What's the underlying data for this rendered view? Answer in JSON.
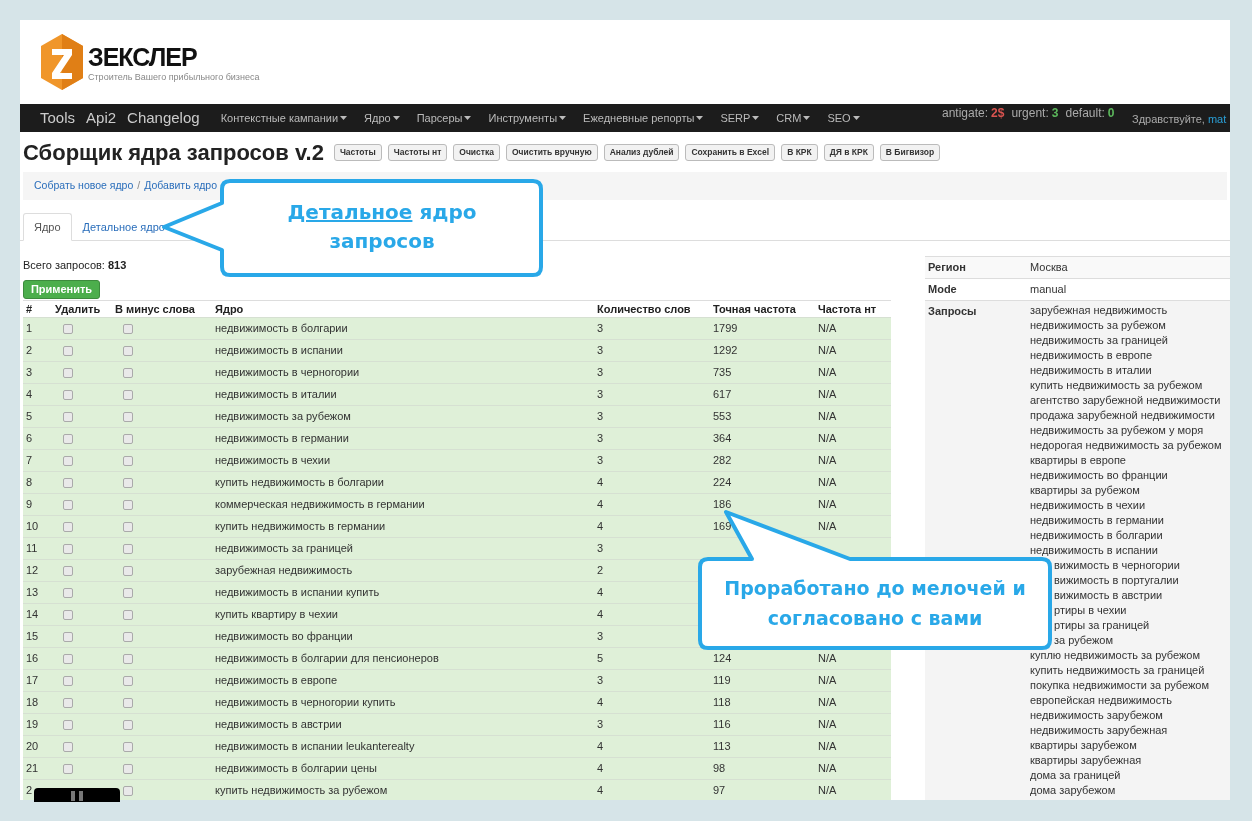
{
  "logo": {
    "name": "ЗЕКСЛЕР",
    "tagline": "Строитель Вашего прибыльного бизнеса"
  },
  "nav": {
    "main": [
      "Tools",
      "Api2",
      "Changelog"
    ],
    "menus": [
      "Контекстные кампании",
      "Ядро",
      "Парсеры",
      "Инструменты",
      "Ежедневные репорты",
      "SERP",
      "CRM",
      "SEO"
    ],
    "status": [
      {
        "label": "antigate:",
        "value": "2$",
        "color": "#d9534f"
      },
      {
        "label": "urgent:",
        "value": "3",
        "color": "#5cb85c"
      },
      {
        "label": "default:",
        "value": "0",
        "color": "#5cb85c"
      }
    ],
    "greeting": "Здравствуйте,",
    "user": "mat"
  },
  "title": "Сборщик ядра запросов v.2",
  "actions": [
    "Частоты",
    "Частоты нт",
    "Очистка",
    "Очистить вручную",
    "Анализ дублей",
    "Сохранить в Excel",
    "В КРК",
    "ДЯ в КРК",
    "В Бигвизор"
  ],
  "breadcrumb": {
    "items": [
      "Собрать новое ядро",
      "Добавить ядро"
    ],
    "separator": "/"
  },
  "tabs": [
    {
      "label": "Ядро",
      "selected": true
    },
    {
      "label": "Детальное ядро",
      "selected": false
    }
  ],
  "total": "Всего запросов: **813**",
  "apply_button": "Применить",
  "table": {
    "columns": [
      "#",
      "Удалить",
      "В минус слова",
      "Ядро",
      "Количество слов",
      "Точная частота",
      "Частота нт"
    ],
    "rows": [
      {
        "n": "1",
        "delete": false,
        "minus": false,
        "phrase": "недвижимость в болгарии",
        "words": "3",
        "freq": "1799",
        "nt": "N/A"
      },
      {
        "n": "2",
        "delete": false,
        "minus": false,
        "phrase": "недвижимость в испании",
        "words": "3",
        "freq": "1292",
        "nt": "N/A"
      },
      {
        "n": "3",
        "delete": false,
        "minus": false,
        "phrase": "недвижимость в черногории",
        "words": "3",
        "freq": "735",
        "nt": "N/A"
      },
      {
        "n": "4",
        "delete": false,
        "minus": false,
        "phrase": "недвижимость в италии",
        "words": "3",
        "freq": "617",
        "nt": "N/A"
      },
      {
        "n": "5",
        "delete": false,
        "minus": false,
        "phrase": "недвижимость за рубежом",
        "words": "3",
        "freq": "553",
        "nt": "N/A"
      },
      {
        "n": "6",
        "delete": false,
        "minus": false,
        "phrase": "недвижимость в германии",
        "words": "3",
        "freq": "364",
        "nt": "N/A"
      },
      {
        "n": "7",
        "delete": false,
        "minus": false,
        "phrase": "недвижимость в чехии",
        "words": "3",
        "freq": "282",
        "nt": "N/A"
      },
      {
        "n": "8",
        "delete": false,
        "minus": false,
        "phrase": "купить недвижимость в болгарии",
        "words": "4",
        "freq": "224",
        "nt": "N/A"
      },
      {
        "n": "9",
        "delete": false,
        "minus": false,
        "phrase": "коммерческая недвижимость в германии",
        "words": "4",
        "freq": "186",
        "nt": "N/A"
      },
      {
        "n": "10",
        "delete": false,
        "minus": false,
        "phrase": "купить недвижимость в германии",
        "words": "4",
        "freq": "169",
        "nt": "N/A"
      },
      {
        "n": "11",
        "delete": false,
        "minus": false,
        "phrase": "недвижимость за границей",
        "words": "3"
      },
      {
        "n": "12",
        "delete": false,
        "minus": false,
        "phrase": "зарубежная недвижимость",
        "words": "2"
      },
      {
        "n": "13",
        "delete": false,
        "minus": false,
        "phrase": "недвижимость в испании купить",
        "words": "4"
      },
      {
        "n": "14",
        "delete": false,
        "minus": false,
        "phrase": "купить квартиру в чехии",
        "words": "4"
      },
      {
        "n": "15",
        "delete": false,
        "minus": false,
        "phrase": "недвижимость во франции",
        "words": "3"
      },
      {
        "n": "16",
        "delete": false,
        "minus": false,
        "phrase": "недвижимость в болгарии для пенсионеров",
        "words": "5",
        "freq": "124",
        "nt": "N/A"
      },
      {
        "n": "17",
        "delete": false,
        "minus": false,
        "phrase": "недвижимость в европе",
        "words": "3",
        "freq": "119",
        "nt": "N/A"
      },
      {
        "n": "18",
        "delete": false,
        "minus": false,
        "phrase": "недвижимость в черногории купить",
        "words": "4",
        "freq": "118",
        "nt": "N/A"
      },
      {
        "n": "19",
        "delete": false,
        "minus": false,
        "phrase": "недвижимость в австрии",
        "words": "3",
        "freq": "116",
        "nt": "N/A"
      },
      {
        "n": "20",
        "delete": false,
        "minus": false,
        "phrase": "недвижимость в испании leukanterealty",
        "words": "4",
        "freq": "113",
        "nt": "N/A"
      },
      {
        "n": "21",
        "delete": false,
        "minus": false,
        "phrase": "недвижимость в болгарии цены",
        "words": "4",
        "freq": "98",
        "nt": "N/A"
      },
      {
        "n": "2",
        "minus": false,
        "phrase": "купить недвижимость за рубежом",
        "words": "4",
        "freq": "97",
        "nt": "N/A"
      }
    ]
  },
  "info": {
    "rows": [
      {
        "label": "Регион",
        "value": "Москва"
      },
      {
        "label": "Mode",
        "value": "manual"
      }
    ],
    "queries_label": "Запросы",
    "queries": [
      {
        "text": "зарубежная недвижимость",
        "kind": "full"
      },
      {
        "text": "недвижимость за рубежом",
        "kind": "full"
      },
      {
        "text": "недвижимость за границей",
        "kind": "full"
      },
      {
        "text": "недвижимость в европе",
        "kind": "full"
      },
      {
        "text": "недвижимость в италии",
        "kind": "full"
      },
      {
        "text": "купить недвижимость за рубежом",
        "kind": "full"
      },
      {
        "text": "агентство зарубежной недвижимости",
        "kind": "full"
      },
      {
        "text": "продажа зарубежной недвижимости",
        "kind": "full"
      },
      {
        "text": "недвижимость за рубежом у моря",
        "kind": "full"
      },
      {
        "text": "недорогая недвижимость за рубежом",
        "kind": "full"
      },
      {
        "text": "квартиры в европе",
        "kind": "full"
      },
      {
        "text": "недвижимость во франции",
        "kind": "full"
      },
      {
        "text": "квартиры за рубежом",
        "kind": "full"
      },
      {
        "text": "недвижимость в чехии",
        "kind": "full"
      },
      {
        "text": "недвижимость в германии",
        "kind": "full"
      },
      {
        "text": "недвижимость в болгарии",
        "kind": "full"
      },
      {
        "text": "недвижимость в испании",
        "kind": "full"
      },
      {
        "text": "вижимость в черногории",
        "kind": "partial"
      },
      {
        "text": "вижимость в португалии",
        "kind": "partial"
      },
      {
        "text": "вижимость в австрии",
        "kind": "partial"
      },
      {
        "text": "ртиры в чехии",
        "kind": "partial"
      },
      {
        "text": "ртиры за границей",
        "kind": "partial"
      },
      {
        "text": "за рубежом",
        "kind": "partial"
      },
      {
        "text": "куплю недвижимость за рубежом",
        "kind": "full"
      },
      {
        "text": "купить недвижимость за границей",
        "kind": "full"
      },
      {
        "text": "покупка недвижимости за рубежом",
        "kind": "full"
      },
      {
        "text": "европейская недвижимость",
        "kind": "full"
      },
      {
        "text": "недвижимость зарубежом",
        "kind": "full"
      },
      {
        "text": "недвижимость зарубежная",
        "kind": "full"
      },
      {
        "text": "квартиры зарубежом",
        "kind": "full"
      },
      {
        "text": "квартиры зарубежная",
        "kind": "full"
      },
      {
        "text": "дома за границей",
        "kind": "full"
      },
      {
        "text": "дома зарубежом",
        "kind": "full"
      }
    ]
  },
  "callouts": [
    {
      "link": "Детальное",
      "text": "ядро запросов"
    },
    {
      "text": "Проработано до мелочей и согласовано с вами"
    }
  ]
}
